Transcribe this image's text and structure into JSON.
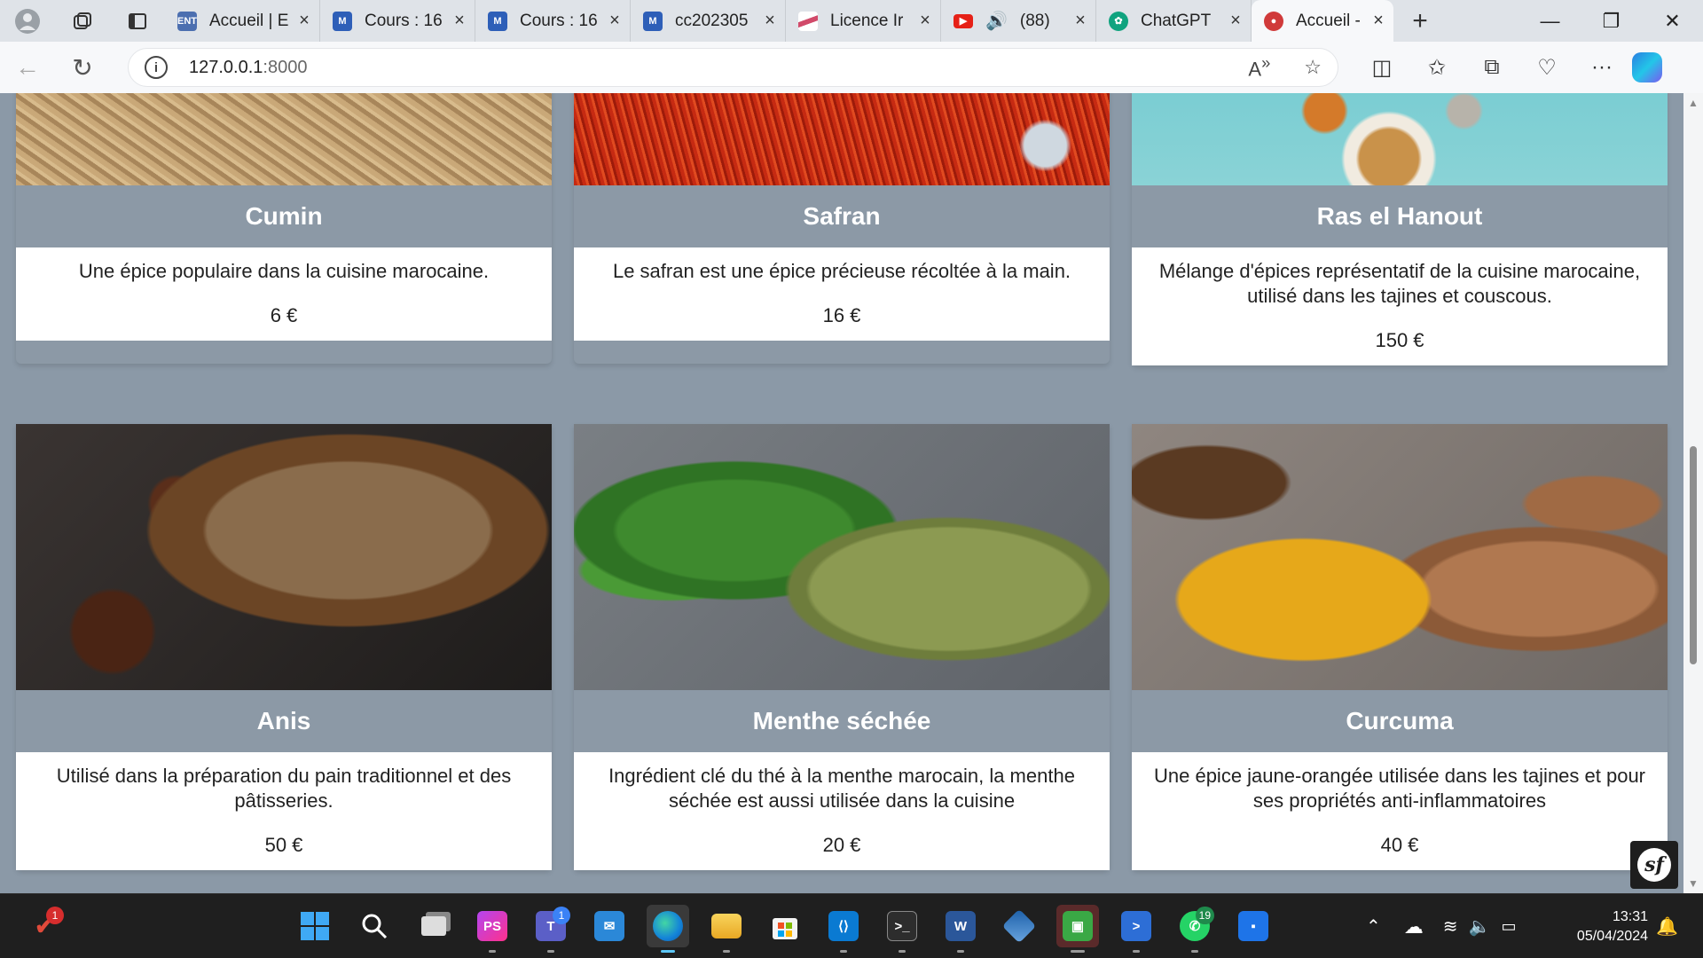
{
  "browser": {
    "tabs": [
      {
        "title": "Accueil | E",
        "favicon": "ent-icon",
        "color": "#4c6fb0"
      },
      {
        "title": "Cours : 16",
        "favicon": "moodle-icon",
        "color": "#2e5fb8"
      },
      {
        "title": "Cours : 16",
        "favicon": "moodle-icon",
        "color": "#2e5fb8"
      },
      {
        "title": "cc202305",
        "favicon": "moodle-icon",
        "color": "#2e5fb8"
      },
      {
        "title": "Licence Ir",
        "favicon": "licence-icon",
        "color": "#c8a0b0"
      },
      {
        "title": "(88)",
        "favicon": "youtube-icon",
        "color": "#e62117"
      },
      {
        "title": "ChatGPT",
        "favicon": "chatgpt-icon",
        "color": "#10a37f"
      },
      {
        "title": "Accueil - ",
        "favicon": "app-icon",
        "color": "#d03a3a",
        "active": true
      }
    ],
    "url_host": "127.0.0.1",
    "url_port": ":8000"
  },
  "products": [
    {
      "name": "Cumin",
      "description": "Une épice populaire dans la cuisine marocaine.",
      "price": "6 €"
    },
    {
      "name": "Safran",
      "description": "Le safran est une épice précieuse récoltée à la main.",
      "price": "16 €"
    },
    {
      "name": "Ras el Hanout",
      "description": "Mélange d'épices représentatif de la cuisine marocaine, utilisé dans les tajines et couscous.",
      "price": "150 €"
    },
    {
      "name": "Anis",
      "description": "Utilisé dans la préparation du pain traditionnel et des pâtisseries.",
      "price": "50 €"
    },
    {
      "name": "Menthe séchée",
      "description": "Ingrédient clé du thé à la menthe marocain, la menthe séchée est aussi utilisée dans la cuisine",
      "price": "20 €"
    },
    {
      "name": "Curcuma",
      "description": "Une épice jaune-orangée utilisée dans les tajines et pour ses propriétés anti-inflammatoires",
      "price": "40 €"
    }
  ],
  "taskbar": {
    "badges": {
      "defender": "1",
      "teams": "1",
      "whatsapp": "19"
    },
    "time": "13:31",
    "date": "05/04/2024"
  }
}
